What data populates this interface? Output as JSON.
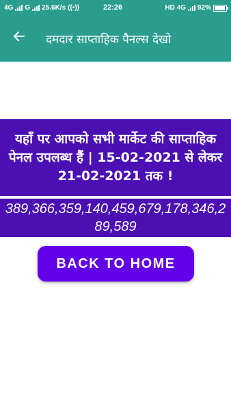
{
  "status_bar": {
    "network_1": "4G",
    "network_2": "G",
    "speed": "25.6K/s",
    "time": "22:26",
    "network_3": "HD 4G",
    "battery": "92%"
  },
  "app_bar": {
    "title": "दमदार साप्ताहिक पैनल्स देखो",
    "back_icon": "arrow-back-icon"
  },
  "info": {
    "text": "यहाँ पर आपको सभी मार्केट की साप्ताहिक पेनल उपलब्ध हैं | 15-02-2021 से लेकर 21-02-2021 तक !"
  },
  "panels": {
    "numbers": "389,366,359,140,459,679,178,346,289,589"
  },
  "button": {
    "label": "BACK TO HOME"
  },
  "colors": {
    "app_bar": "#2a9d8f",
    "info_background": "#4b0fb4",
    "button": "#6200ea"
  }
}
